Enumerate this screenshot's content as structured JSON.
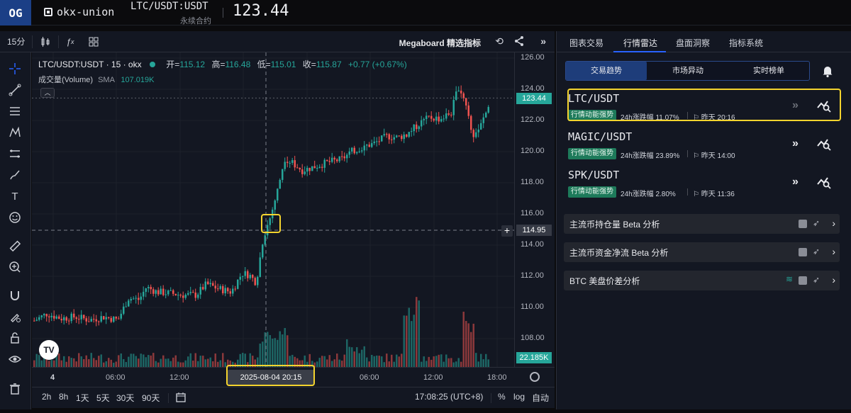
{
  "topbar": {
    "logo_text": "OG",
    "app_name": "okx-union",
    "pair": "LTC/USDT:USDT",
    "pair_sub": "永续合约",
    "price": "123.44"
  },
  "toolbar": {
    "interval": "15分",
    "megaboard": "Megaboard 精选指标"
  },
  "legend": {
    "symbol": "LTC/USDT:USDT · 15 · okx",
    "open_label": "开=",
    "open": "115.12",
    "high_label": "高=",
    "high": "116.48",
    "low_label": "低=",
    "low": "115.01",
    "close_label": "收=",
    "close": "115.87",
    "change": "+0.77 (+0.67%)",
    "volume_label": "成交量(Volume)",
    "volume_sma": "SMA",
    "volume_value": "107.019K"
  },
  "price_scale": {
    "ticks": [
      "126.00",
      "124.00",
      "122.00",
      "120.00",
      "118.00",
      "116.00",
      "114.00",
      "112.00",
      "110.00",
      "108.00"
    ],
    "current_price": "123.44",
    "crosshair_price": "114.95",
    "volume_label": "22.185K"
  },
  "time_axis": {
    "ticks": [
      "4",
      "06:00",
      "12:00",
      "06:00",
      "12:00",
      "18:00"
    ],
    "crosshair_time": "2025-08-04   20:15"
  },
  "bottom_bar": {
    "ranges": [
      "2h",
      "8h",
      "1天",
      "5天",
      "30天",
      "90天"
    ],
    "clock": "17:08:25 (UTC+8)",
    "percent": "%",
    "log": "log",
    "auto": "自动"
  },
  "right_panel": {
    "tabs": [
      "图表交易",
      "行情雷达",
      "盘面洞察",
      "指标系统"
    ],
    "active_tab": "行情雷达",
    "segments": [
      "交易趋势",
      "市场异动",
      "实时榜单"
    ],
    "radar": [
      {
        "symbol": "LTC/USDT",
        "tag": "行情动能强势",
        "change": "24h涨跌幅 11.07%",
        "time": "昨天 20:16"
      },
      {
        "symbol": "MAGIC/USDT",
        "tag": "行情动能强势",
        "change": "24h涨跌幅 23.89%",
        "time": "昨天 14:00"
      },
      {
        "symbol": "SPK/USDT",
        "tag": "行情动能强势",
        "change": "24h涨跌幅 2.80%",
        "time": "昨天 11:36"
      }
    ],
    "analysis": [
      "主流币持仓量 Beta 分析",
      "主流币资金净流 Beta 分析",
      "BTC 美盘价差分析"
    ]
  },
  "colors": {
    "up": "#26a69a",
    "down": "#ef5350",
    "accent": "#2962ff",
    "highlight": "#f4d42e"
  }
}
